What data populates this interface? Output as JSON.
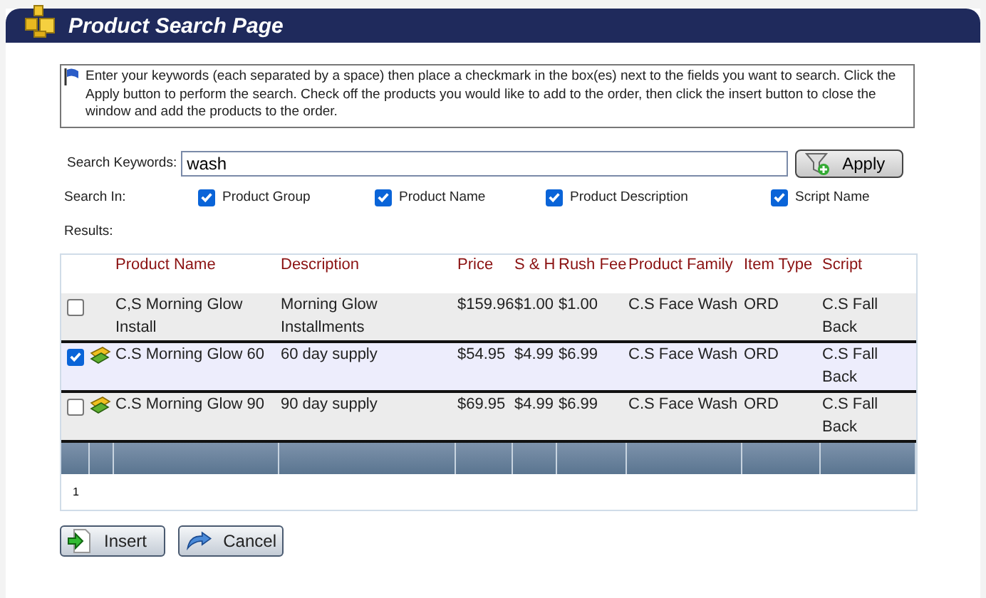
{
  "window": {
    "title": "Product Search Page"
  },
  "instructions": "Enter your keywords (each separated by a space) then place a checkmark in the box(es) next to the fields you want to search. Click the Apply button to perform the search. Check off the products you would like to add to the order, then click the insert button to close the window and add the products to the order.",
  "search": {
    "label": "Search Keywords:",
    "value": "wash",
    "apply": "Apply"
  },
  "search_in": {
    "label": "Search In:",
    "options": [
      {
        "label": "Product Group",
        "checked": true
      },
      {
        "label": "Product Name",
        "checked": true
      },
      {
        "label": "Product Description",
        "checked": true
      },
      {
        "label": "Script Name",
        "checked": true
      }
    ]
  },
  "results_label": "Results:",
  "table": {
    "columns": [
      "Product Name",
      "Description",
      "Price",
      "S & H",
      "Rush Fee",
      "Product Family",
      "Item Type",
      "Script"
    ],
    "rows": [
      {
        "checked": false,
        "has_icon": false,
        "cells": [
          "C,S Morning Glow Install",
          "Morning Glow Installments",
          "$159.96",
          "$1.00",
          "$1.00",
          "C.S Face Wash",
          "ORD",
          "C.S Fall Back"
        ]
      },
      {
        "checked": true,
        "has_icon": true,
        "cells": [
          "C.S Morning Glow 60",
          "60 day supply",
          "$54.95",
          "$4.99",
          "$6.99",
          "C.S Face Wash",
          "ORD",
          "C.S Fall Back"
        ]
      },
      {
        "checked": false,
        "has_icon": true,
        "cells": [
          "C.S Morning Glow 90",
          "90 day supply",
          "$69.95",
          "$4.99",
          "$6.99",
          "C.S Face Wash",
          "ORD",
          "C.S Fall Back"
        ]
      }
    ],
    "page": "1"
  },
  "buttons": [
    {
      "kind": "insert",
      "label": "Insert"
    },
    {
      "kind": "cancel",
      "label": "Cancel"
    }
  ]
}
